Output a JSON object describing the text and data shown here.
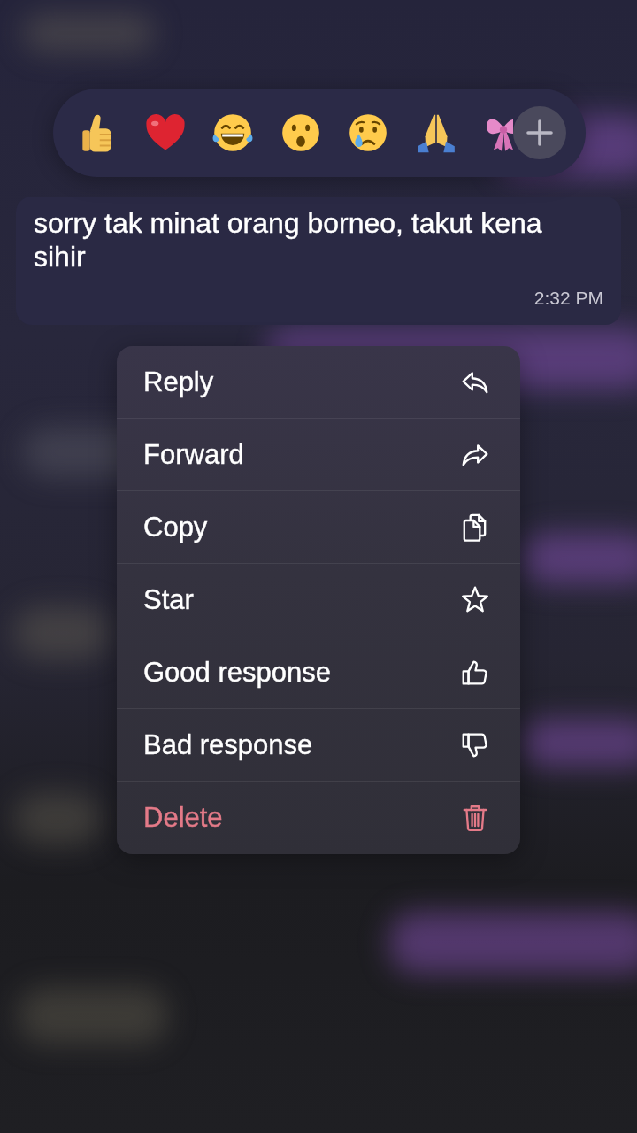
{
  "message": {
    "text": "sorry tak minat orang borneo, takut kena sihir",
    "time": "2:32 PM"
  },
  "context_menu": [
    {
      "label": "Reply",
      "destructive": false
    },
    {
      "label": "Forward",
      "destructive": false
    },
    {
      "label": "Copy",
      "destructive": false
    },
    {
      "label": "Star",
      "destructive": false
    },
    {
      "label": "Good response",
      "destructive": false
    },
    {
      "label": "Bad response",
      "destructive": false
    },
    {
      "label": "Delete",
      "destructive": true
    }
  ]
}
